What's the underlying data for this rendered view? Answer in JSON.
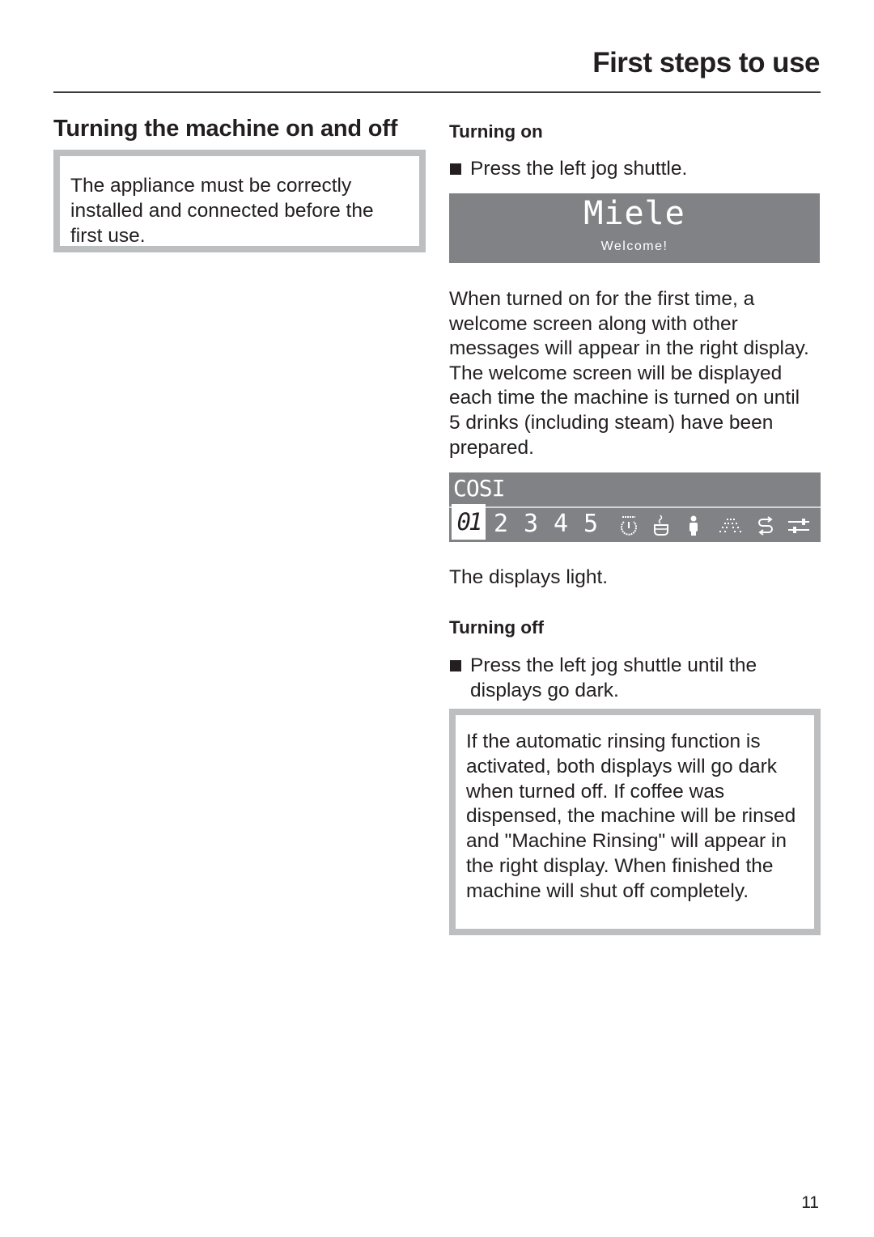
{
  "header": {
    "title": "First steps to use"
  },
  "section": {
    "title": "Turning the machine on and off",
    "note": "The appliance must be correctly installed and connected before the first use."
  },
  "turning_on": {
    "heading": "Turning on",
    "step": "Press the left jog shuttle.",
    "welcome_display": {
      "logo": "Miele",
      "message": "Welcome!"
    },
    "description": "When turned on for the first time, a welcome screen along with other messages will appear in the right display. The welcome screen will be displayed each time the machine is turned on until 5 drinks (including steam) have been prepared.",
    "status_display": {
      "mode": "COSI",
      "selected_cup": "01",
      "cup_numbers": [
        "2",
        "3",
        "4",
        "5"
      ],
      "icons": [
        "power-icon",
        "hot-water-cup-icon",
        "person-profile-icon",
        "spray-lighting-icon",
        "rinse-cycle-icon",
        "settings-sliders-icon"
      ]
    },
    "result": "The displays light."
  },
  "turning_off": {
    "heading": "Turning off",
    "step": "Press the left jog shuttle until the displays go dark.",
    "note": "If the automatic rinsing function is activated, both displays will go dark when turned off. If coffee was dispensed, the machine will be rinsed and \"Machine Rinsing\" will appear in the right display. When finished the machine will shut off completely."
  },
  "footer": {
    "page_number": "11"
  },
  "colors": {
    "text": "#231f20",
    "display_background": "#808285",
    "note_border": "#bcbec0"
  }
}
